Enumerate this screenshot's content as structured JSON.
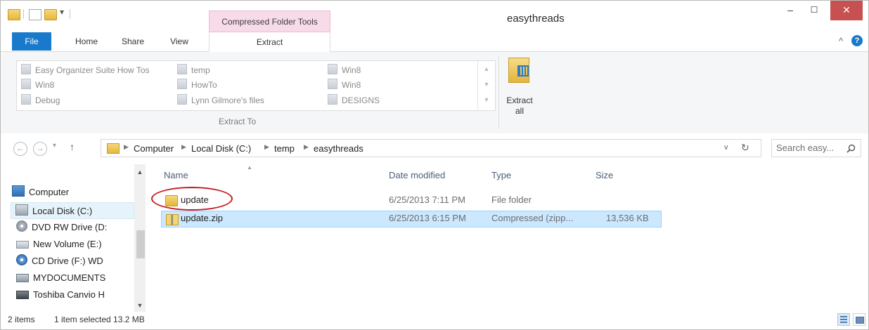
{
  "window": {
    "title": "easythreads",
    "context_tab": "Compressed Folder Tools",
    "controls": {
      "minimize": "–",
      "maximize": "☐",
      "close": "✕"
    }
  },
  "ribbon": {
    "tabs": [
      "File",
      "Home",
      "Share",
      "View",
      "Extract"
    ],
    "active_tab": "Extract",
    "extract_to_items": [
      "Easy Organizer Suite How Tos",
      "temp",
      "Win8",
      "Win8",
      "HowTo",
      "Win8",
      "Debug",
      "Lynn Gilmore's files",
      "DESIGNS"
    ],
    "group_label": "Extract To",
    "extract_all_label": "Extract all",
    "collapse_glyph": "^",
    "help_glyph": "?"
  },
  "address": {
    "back_glyph": "←",
    "forward_glyph": "→",
    "up_glyph": "↑",
    "breadcrumb": [
      "Computer",
      "Local Disk (C:)",
      "temp",
      "easythreads"
    ],
    "dropdown_glyph": "v",
    "refresh_glyph": "↻",
    "search_placeholder": "Search easy...",
    "search_icon": "magnifier-icon"
  },
  "navigation_pane": {
    "items": [
      {
        "label": "Computer",
        "icon": "computer-icon"
      },
      {
        "label": "Local Disk (C:)",
        "icon": "drive-icon",
        "selected": true
      },
      {
        "label": "DVD RW Drive (D:",
        "icon": "dvd-icon"
      },
      {
        "label": "New Volume (E:)",
        "icon": "drive-icon"
      },
      {
        "label": "CD Drive (F:) WD",
        "icon": "cd-icon"
      },
      {
        "label": "MYDOCUMENTS",
        "icon": "network-drive-icon"
      },
      {
        "label": "Toshiba Canvio H",
        "icon": "usb-drive-icon"
      }
    ]
  },
  "file_list": {
    "columns": [
      "Name",
      "Date modified",
      "Type",
      "Size"
    ],
    "rows": [
      {
        "name": "update",
        "date": "6/25/2013 7:11 PM",
        "type": "File folder",
        "size": "",
        "icon": "folder-icon",
        "selected": false
      },
      {
        "name": "update.zip",
        "date": "6/25/2013 6:15 PM",
        "type": "Compressed (zipp...",
        "size": "13,536 KB",
        "icon": "zip-folder-icon",
        "selected": true
      }
    ]
  },
  "status_bar": {
    "item_count": "2 items",
    "selection": "1 item selected 13.2 MB"
  },
  "colors": {
    "file_tab": "#1979ca",
    "context_tab": "#f8dbe8",
    "selection": "#cce8ff",
    "annotation": "#c21e25",
    "close_button": "#c75050"
  }
}
